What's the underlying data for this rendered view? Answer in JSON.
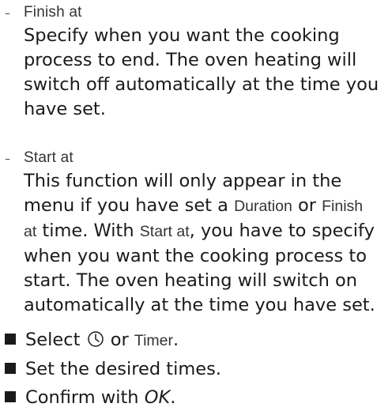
{
  "options": [
    {
      "dash": "-",
      "label": "Finish at",
      "description": "Specify when you want the cooking process to end. The oven heating will switch off automatically at the time you have set."
    },
    {
      "dash": "-",
      "label": "Start at",
      "desc_part1": "This function will only appear in the menu if you have set a ",
      "term_duration": "Duration",
      "desc_part2": " or ",
      "term_finish": "Finish at",
      "desc_part3": " time. With ",
      "term_start": "Start at",
      "desc_part4": ", you have to specify when you want the cooking process to start. The oven heating will switch on automatically at the time you have set."
    }
  ],
  "steps": [
    {
      "before": "Select ",
      "icon": "clock-icon",
      "middle": " or ",
      "term": "Timer",
      "after": "."
    },
    {
      "text": "Set the desired times."
    },
    {
      "before": "Confirm with ",
      "key": "OK",
      "after": "."
    }
  ]
}
